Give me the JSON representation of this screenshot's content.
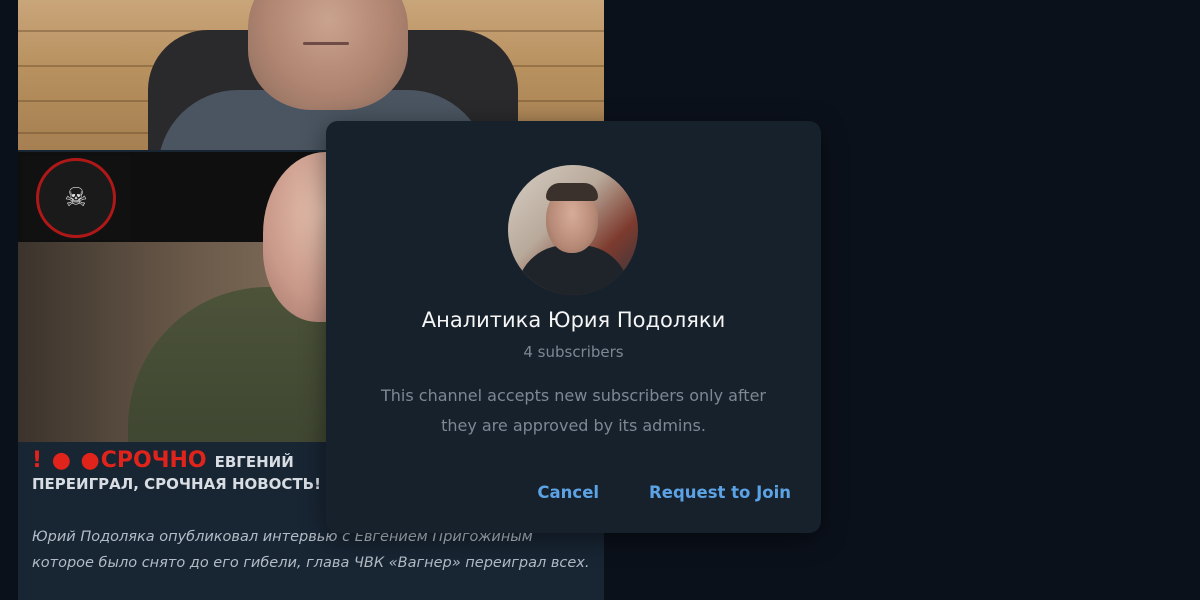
{
  "post": {
    "alarm_marks": "! ● ●",
    "urgent_label": "СРОЧНО",
    "headline_rest_line1": "ЕВГЕНИЙ",
    "headline_line2": "ПЕРЕИГРАЛ, СРОЧНАЯ НОВОСТЬ!",
    "body_text": "Юрий Подоляка опубликовал интервью с Евгением Пригожиным которое было снято до его гибели, глава ЧВК «Вагнер» переиграл всех.",
    "badge_icon": "skull-emblem-icon"
  },
  "dialog": {
    "channel_name": "Аналитика Юрия Подоляки",
    "subscribers": "4 subscribers",
    "description": "This channel accepts new subscribers only after they are approved by its admins.",
    "cancel_label": "Cancel",
    "request_label": "Request to Join",
    "accent_color": "#5ca3e6"
  }
}
